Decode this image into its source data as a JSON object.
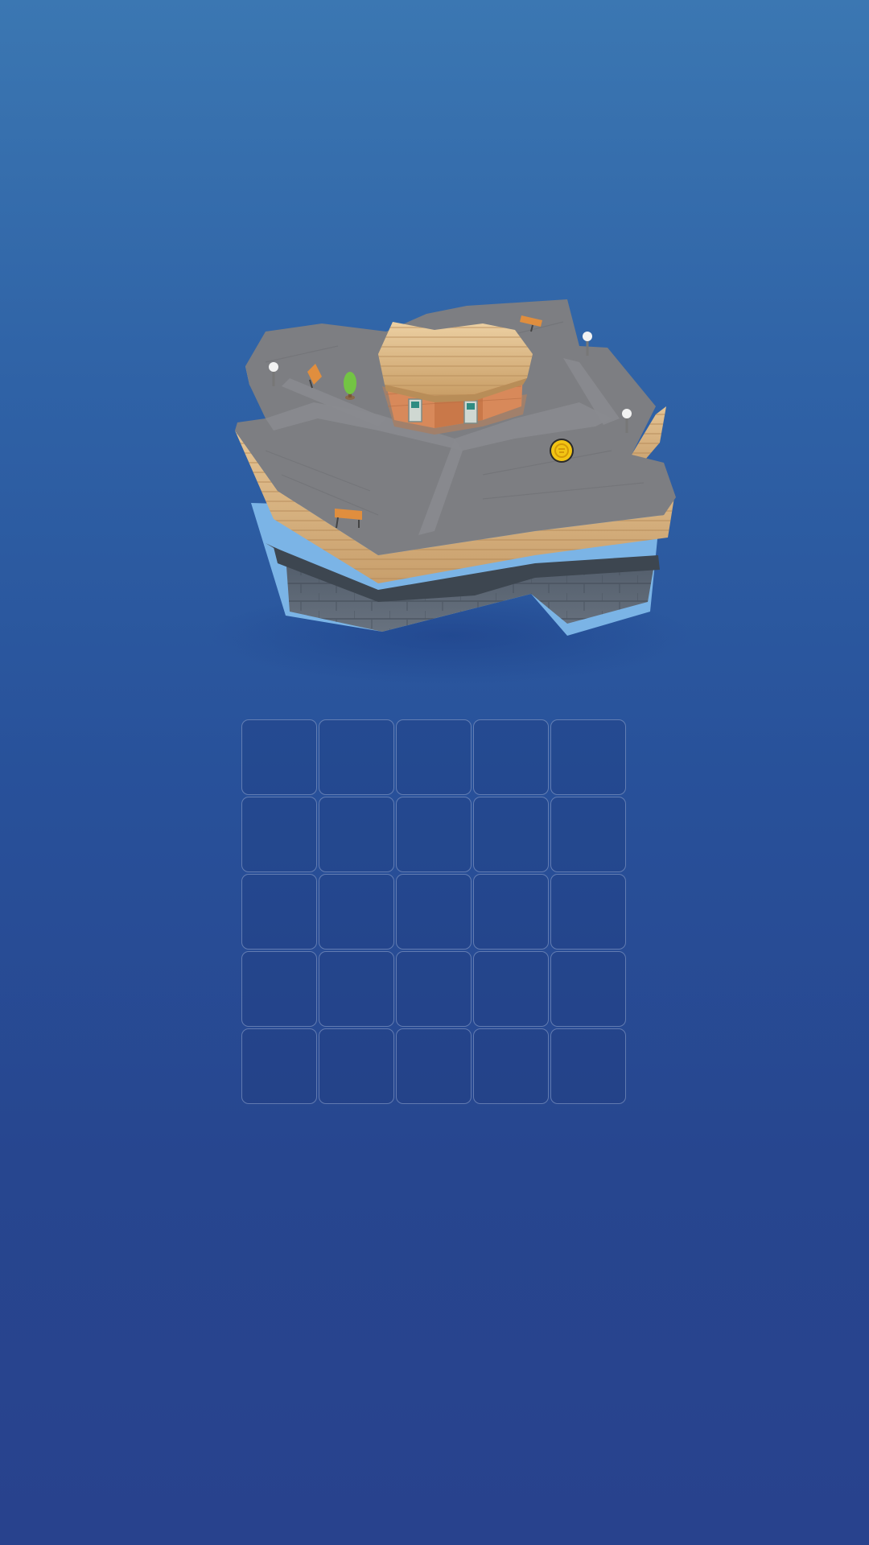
{
  "game": {
    "board": {
      "rows": 5,
      "columns": 5,
      "cells_filled": 0
    },
    "island": {
      "objects": [
        "house",
        "tree",
        "bench",
        "bench",
        "bench",
        "lamp",
        "lamp",
        "lamp",
        "coin"
      ]
    },
    "colors": {
      "background_top": "#3b77b2",
      "background_bottom": "#28428d",
      "pavement": "#7d7e82",
      "wood": "#d9b47e",
      "stone": "#56606d",
      "shallow_water": "#7bb4e6",
      "house_wall": "#d8895a",
      "coin": "#f2c414"
    }
  }
}
